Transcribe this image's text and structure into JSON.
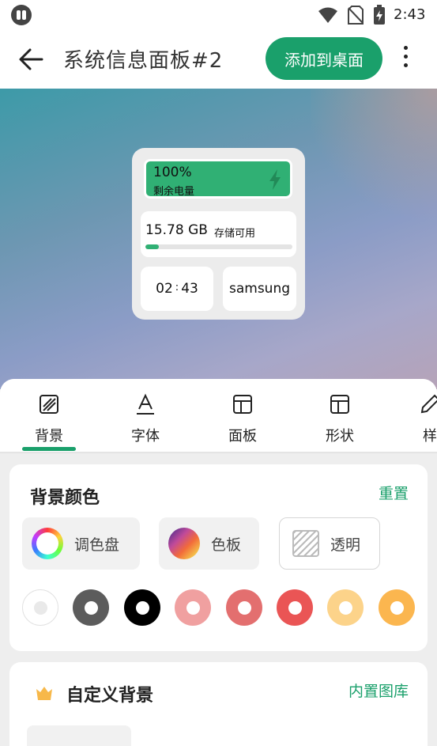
{
  "status_bar": {
    "time": "2:43"
  },
  "app_bar": {
    "title": "系统信息面板#2",
    "add_button": "添加到桌面"
  },
  "widget": {
    "battery_percent": "100%",
    "battery_label": "剩余电量",
    "storage_value": "15.78 GB",
    "storage_label": "存储可用",
    "storage_used_fraction": 0.09,
    "time_hour": "02",
    "time_separator": ":",
    "time_minute": "43",
    "device_name": "samsung",
    "accent_color": "#30b074"
  },
  "tabs": [
    {
      "label": "背景",
      "icon": "background-icon",
      "active": true
    },
    {
      "label": "字体",
      "icon": "font-icon"
    },
    {
      "label": "面板",
      "icon": "panel-icon"
    },
    {
      "label": "形状",
      "icon": "shape-icon"
    },
    {
      "label": "样",
      "icon": "style-icon"
    }
  ],
  "background_color": {
    "title": "背景颜色",
    "reset": "重置",
    "options": [
      {
        "label": "调色盘",
        "icon": "color-wheel-icon"
      },
      {
        "label": "色板",
        "icon": "swatch-icon"
      },
      {
        "label": "透明",
        "icon": "transparent-icon"
      }
    ],
    "colors": [
      "#ffffff",
      "#5c5c5c",
      "#000000",
      "#f0a0a0",
      "#e36f6f",
      "#ea5555",
      "#fcd38a",
      "#fbb64f"
    ]
  },
  "custom_background": {
    "title": "自定义背景",
    "gallery": "内置图库"
  },
  "theme": {
    "primary": "#1aa06b"
  }
}
